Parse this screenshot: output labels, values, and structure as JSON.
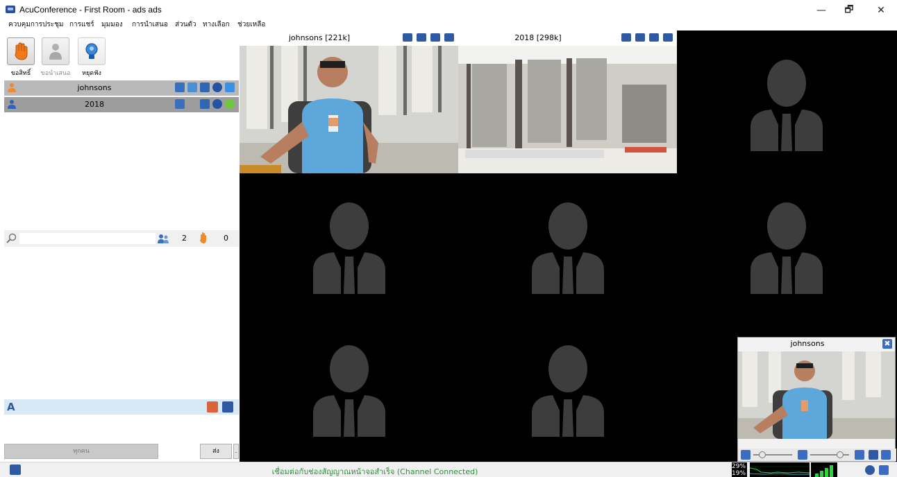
{
  "window": {
    "title": "AcuConference - First Room - ads ads",
    "minimize": "—",
    "maximize": "🗗",
    "close": "✕"
  },
  "menu": [
    "ควบคุมการประชุม",
    "การแชร์",
    "มุมมอง",
    "การนำเสนอ",
    "ส่วนตัว",
    "ทางเลือก",
    "ช่วยเหลือ"
  ],
  "toolbar": {
    "raise_hand": "ขอสิทธิ์",
    "request_present": "ขอนำเสนอ",
    "stop_listening": "หยุดฟัง"
  },
  "participants": [
    {
      "name": "johnsons"
    },
    {
      "name": "2018"
    }
  ],
  "search": {
    "placeholder": "",
    "user_count": "2",
    "hand_count": "0"
  },
  "chat": {
    "recipient": "ทุกคน",
    "send_label": "ส่ง",
    "more": "."
  },
  "videos": [
    {
      "title": "johnsons [221k]"
    },
    {
      "title": "2018 [298k]"
    }
  ],
  "self_view": {
    "title": "johnsons",
    "close": "✖"
  },
  "status": {
    "text": "เชื่อมต่อกับช่องสัญญาณหน้าจอสำเร็จ (Channel Connected)",
    "cpu_top": "29%",
    "cpu_bottom": "19%"
  },
  "colors": {
    "accent": "#2f5aa3",
    "status_text": "#2c8f3a",
    "row_selected": "#9d9d9d",
    "row_normal": "#b9b9b9",
    "video_bg": "#000000",
    "placeholder": "#3d3d3d"
  }
}
